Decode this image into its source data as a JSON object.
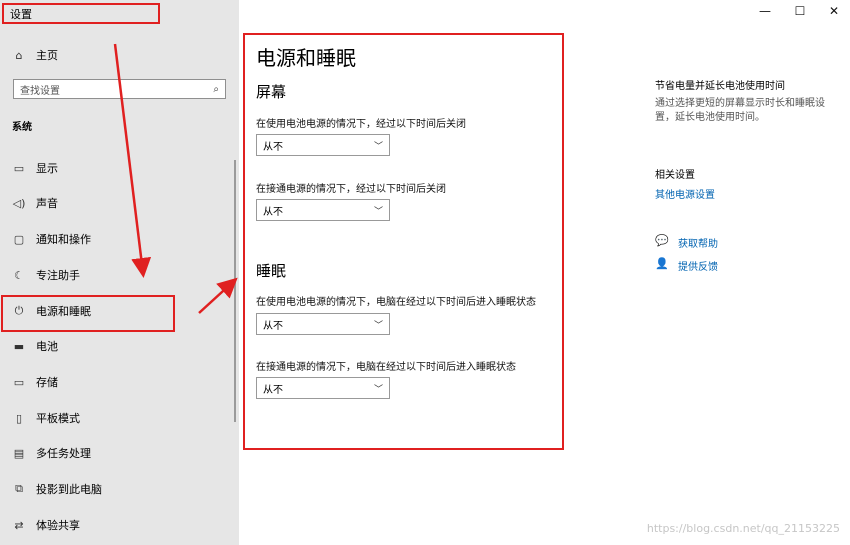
{
  "app": {
    "title": "设置"
  },
  "window": {
    "minimize": "—",
    "maximize": "☐",
    "close": "✕"
  },
  "sidebar": {
    "home": {
      "icon": "home-icon",
      "label": "主页"
    },
    "search": {
      "placeholder": "查找设置"
    },
    "section_label": "系统",
    "items": [
      {
        "icon": "display-icon",
        "label": "显示"
      },
      {
        "icon": "sound-icon",
        "label": "声音"
      },
      {
        "icon": "notification-icon",
        "label": "通知和操作"
      },
      {
        "icon": "focus-assist-icon",
        "label": "专注助手"
      },
      {
        "icon": "power-icon",
        "label": "电源和睡眠"
      },
      {
        "icon": "battery-icon",
        "label": "电池"
      },
      {
        "icon": "storage-icon",
        "label": "存储"
      },
      {
        "icon": "tablet-mode-icon",
        "label": "平板模式"
      },
      {
        "icon": "multitasking-icon",
        "label": "多任务处理"
      },
      {
        "icon": "project-icon",
        "label": "投影到此电脑"
      },
      {
        "icon": "shared-experience-icon",
        "label": "体验共享"
      }
    ]
  },
  "main": {
    "title": "电源和睡眠",
    "screen": {
      "title": "屏幕",
      "battery_label": "在使用电池电源的情况下，经过以下时间后关闭",
      "battery_value": "从不",
      "plugged_label": "在接通电源的情况下，经过以下时间后关闭",
      "plugged_value": "从不"
    },
    "sleep": {
      "title": "睡眠",
      "battery_label": "在使用电池电源的情况下，电脑在经过以下时间后进入睡眠状态",
      "battery_value": "从不",
      "plugged_label": "在接通电源的情况下，电脑在经过以下时间后进入睡眠状态",
      "plugged_value": "从不"
    }
  },
  "right_pane": {
    "tip_title": "节省电量并延长电池使用时间",
    "tip_desc": "通过选择更短的屏幕显示时长和睡眠设置，延长电池使用时间。",
    "related_title": "相关设置",
    "related_link": "其他电源设置",
    "help_link": "获取帮助",
    "feedback_link": "提供反馈"
  },
  "watermark": "https://blog.csdn.net/qq_21153225",
  "colors": {
    "annotation": "#e02020",
    "link": "#0063b1",
    "sidebar_bg": "#e6e6e6"
  }
}
